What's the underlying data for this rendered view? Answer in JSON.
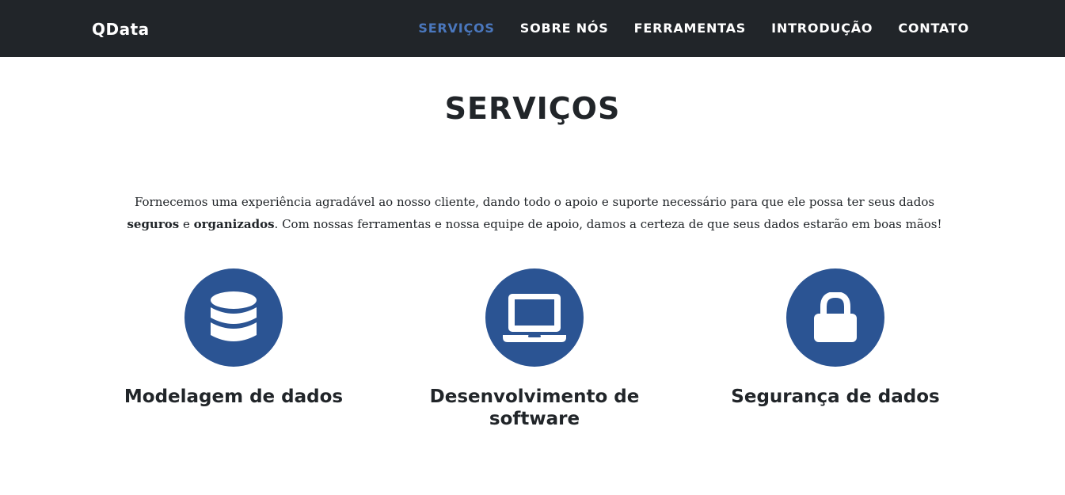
{
  "nav": {
    "brand": "QData",
    "items": [
      {
        "label": "SERVIÇOS",
        "active": true
      },
      {
        "label": "SOBRE NÓS",
        "active": false
      },
      {
        "label": "FERRAMENTAS",
        "active": false
      },
      {
        "label": "INTRODUÇÃO",
        "active": false
      },
      {
        "label": "CONTATO",
        "active": false
      }
    ]
  },
  "services_section": {
    "title": "SERVIÇOS",
    "intro": {
      "part1": "Fornecemos uma experiência agradável ao nosso cliente, dando todo o apoio e suporte necessário para que ele possa ter seus dados ",
      "bold1": "seguros",
      "part2": " e ",
      "bold2": "organizados",
      "part3": ". Com nossas ferramentas e nossa equipe de apoio, damos a certeza de que seus dados estarão em boas mãos!"
    },
    "items": [
      {
        "icon": "database-icon",
        "title": "Modelagem de dados"
      },
      {
        "icon": "laptop-icon",
        "title": "Desenvolvimento de software"
      },
      {
        "icon": "lock-icon",
        "title": "Segurança de dados"
      }
    ]
  },
  "colors": {
    "navbar_bg": "#212529",
    "accent": "#4a77bd",
    "icon_circle": "#2b5493",
    "text": "#212529"
  }
}
